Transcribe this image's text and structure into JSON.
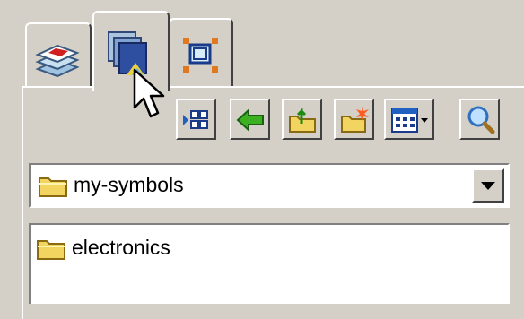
{
  "tabs": [
    {
      "name": "layers",
      "icon": "layers-icon",
      "active": false
    },
    {
      "name": "symbols",
      "icon": "symbols-stack-icon",
      "active": true
    },
    {
      "name": "objects",
      "icon": "select-object-icon",
      "active": false
    }
  ],
  "toolbar": {
    "buttons": [
      {
        "icon": "view-options-icon"
      },
      {
        "icon": "back-arrow-icon"
      },
      {
        "icon": "up-folder-icon"
      },
      {
        "icon": "new-folder-icon"
      },
      {
        "icon": "view-menu-icon"
      },
      {
        "icon": "search-icon"
      }
    ]
  },
  "folder_select": {
    "selected": "my-symbols"
  },
  "folder_list": {
    "items": [
      "electronics"
    ]
  },
  "colors": {
    "face": "#d4d0c8",
    "folder_yellow": "#f2d461",
    "accent_blue": "#2e4fa0"
  }
}
